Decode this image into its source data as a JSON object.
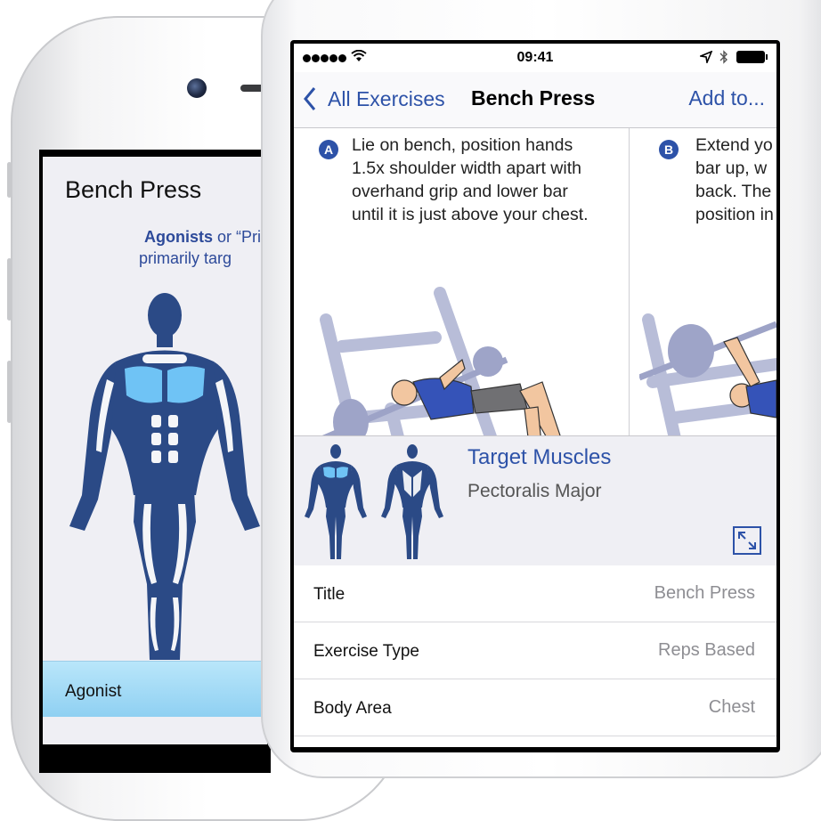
{
  "back_screen": {
    "title": "Bench Press",
    "subtitle_bold": "Agonists",
    "subtitle_rest": " or “Prime",
    "subtitle_line2": "primarily targ",
    "agonist_label": "Agonist"
  },
  "status_bar": {
    "time": "09:41"
  },
  "nav": {
    "back_label": "All Exercises",
    "title": "Bench Press",
    "action_label": "Add to..."
  },
  "steps": [
    {
      "letter": "A",
      "text_lines": [
        "Lie on bench, position hands",
        "1.5x shoulder width apart with",
        "overhand grip and lower bar",
        "until it is just above your chest."
      ]
    },
    {
      "letter": "B",
      "text_lines": [
        "Extend yo",
        "bar up, w",
        "back. The",
        "position in"
      ]
    }
  ],
  "target": {
    "title": "Target Muscles",
    "value": "Pectoralis Major"
  },
  "details": [
    {
      "label": "Title",
      "value": "Bench Press"
    },
    {
      "label": "Exercise Type",
      "value": "Reps Based"
    },
    {
      "label": "Body Area",
      "value": "Chest"
    }
  ],
  "colors": {
    "accent": "#2d52a8",
    "muscle_dark": "#2b4a86",
    "muscle_highlight": "#6fc3f5",
    "agonist_bar": "#a9def7"
  }
}
